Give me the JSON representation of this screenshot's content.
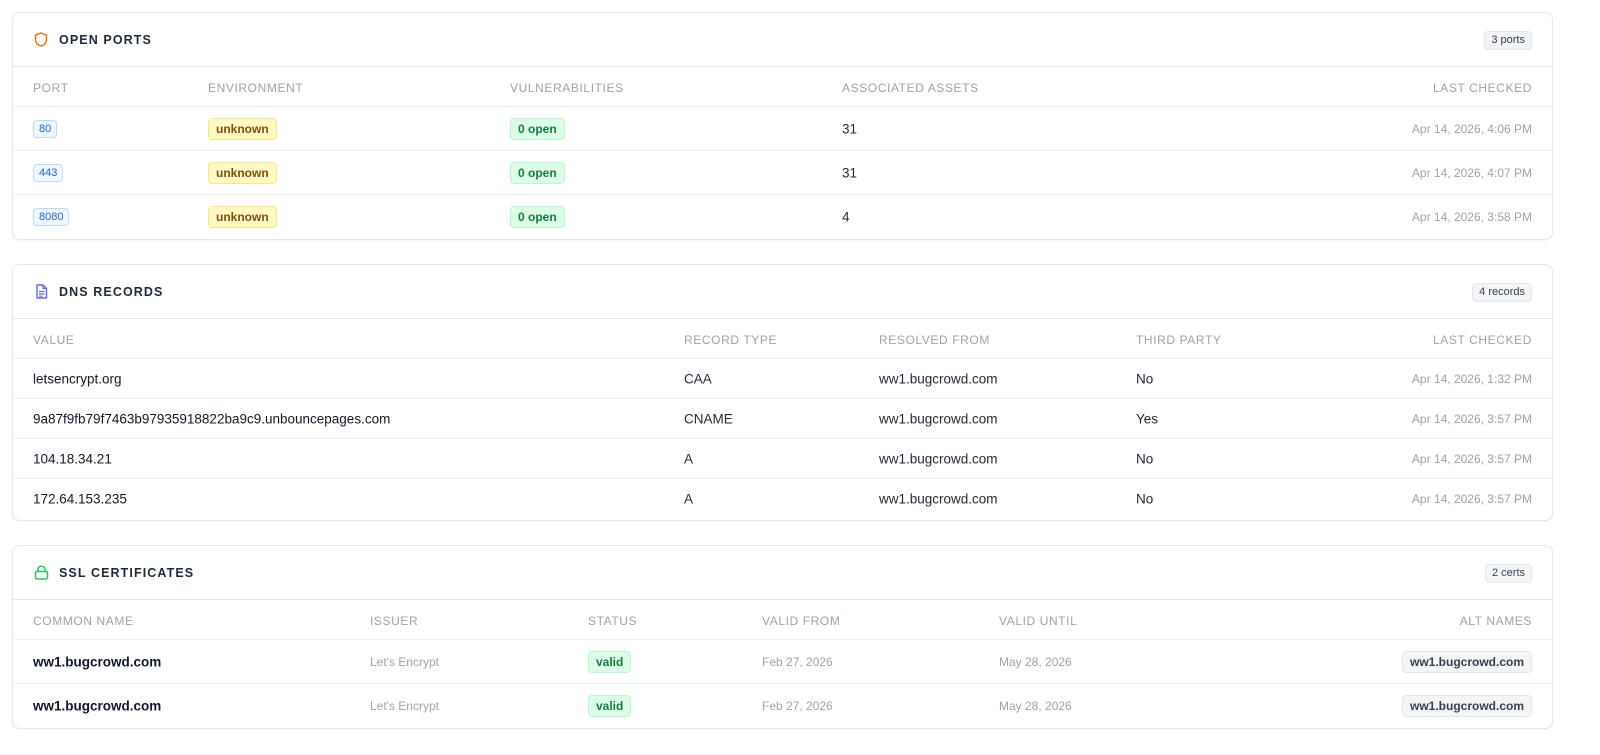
{
  "open_ports": {
    "title": "OPEN PORTS",
    "icon": "shield-icon",
    "icon_color": "#f97316",
    "count": "3 ports",
    "columns": [
      "PORT",
      "ENVIRONMENT",
      "VULNERABILITIES",
      "ASSOCIATED ASSETS",
      "LAST CHECKED"
    ],
    "rows": [
      {
        "port": "80",
        "environment": "unknown",
        "vulnerabilities": "0 open",
        "assets": "31",
        "last_checked": "Apr 14, 2026, 4:06 PM"
      },
      {
        "port": "443",
        "environment": "unknown",
        "vulnerabilities": "0 open",
        "assets": "31",
        "last_checked": "Apr 14, 2026, 4:07 PM"
      },
      {
        "port": "8080",
        "environment": "unknown",
        "vulnerabilities": "0 open",
        "assets": "4",
        "last_checked": "Apr 14, 2026, 3:58 PM"
      }
    ]
  },
  "dns_records": {
    "title": "DNS RECORDS",
    "icon": "document-icon",
    "icon_color": "#6366f1",
    "count": "4 records",
    "columns": [
      "VALUE",
      "RECORD TYPE",
      "RESOLVED FROM",
      "THIRD PARTY",
      "LAST CHECKED"
    ],
    "rows": [
      {
        "value": "letsencrypt.org",
        "record_type": "CAA",
        "resolved_from": "ww1.bugcrowd.com",
        "third_party": "No",
        "last_checked": "Apr 14, 2026, 1:32 PM"
      },
      {
        "value": "9a87f9fb79f7463b97935918822ba9c9.unbouncepages.com",
        "record_type": "CNAME",
        "resolved_from": "ww1.bugcrowd.com",
        "third_party": "Yes",
        "last_checked": "Apr 14, 2026, 3:57 PM"
      },
      {
        "value": "104.18.34.21",
        "record_type": "A",
        "resolved_from": "ww1.bugcrowd.com",
        "third_party": "No",
        "last_checked": "Apr 14, 2026, 3:57 PM"
      },
      {
        "value": "172.64.153.235",
        "record_type": "A",
        "resolved_from": "ww1.bugcrowd.com",
        "third_party": "No",
        "last_checked": "Apr 14, 2026, 3:57 PM"
      }
    ]
  },
  "ssl_certificates": {
    "title": "SSL CERTIFICATES",
    "icon": "lock-icon",
    "icon_color": "#22c55e",
    "count": "2 certs",
    "columns": [
      "COMMON NAME",
      "ISSUER",
      "STATUS",
      "VALID FROM",
      "VALID UNTIL",
      "ALT NAMES"
    ],
    "rows": [
      {
        "common_name": "ww1.bugcrowd.com",
        "issuer": "Let's Encrypt",
        "status": "valid",
        "valid_from": "Feb 27, 2026",
        "valid_until": "May 28, 2026",
        "alt_names": "ww1.bugcrowd.com"
      },
      {
        "common_name": "ww1.bugcrowd.com",
        "issuer": "Let's Encrypt",
        "status": "valid",
        "valid_from": "Feb 27, 2026",
        "valid_until": "May 28, 2026",
        "alt_names": "ww1.bugcrowd.com"
      }
    ]
  }
}
